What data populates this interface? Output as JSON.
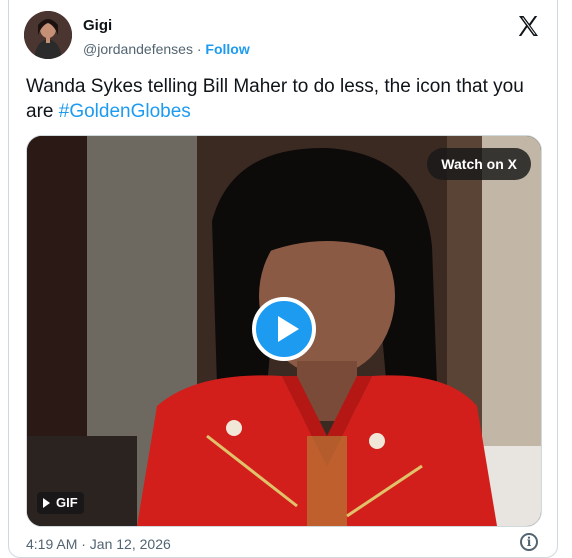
{
  "author": {
    "name": "Gigi",
    "handle": "@jordandefenses",
    "separator": "·",
    "follow_label": "Follow"
  },
  "tweet": {
    "text": "Wanda Sykes telling Bill Maher to do less, the icon that you are ",
    "hashtag": "#GoldenGlobes"
  },
  "media": {
    "watch_label": "Watch on X",
    "gif_label": "GIF"
  },
  "footer": {
    "timestamp": "4:19 AM · Jan 12, 2026",
    "info_glyph": "i"
  },
  "icons": [
    "x-logo-icon",
    "play-icon",
    "info-icon"
  ],
  "colors": {
    "accent": "#1d9bf0",
    "muted": "#536471",
    "text": "#0f1419"
  }
}
